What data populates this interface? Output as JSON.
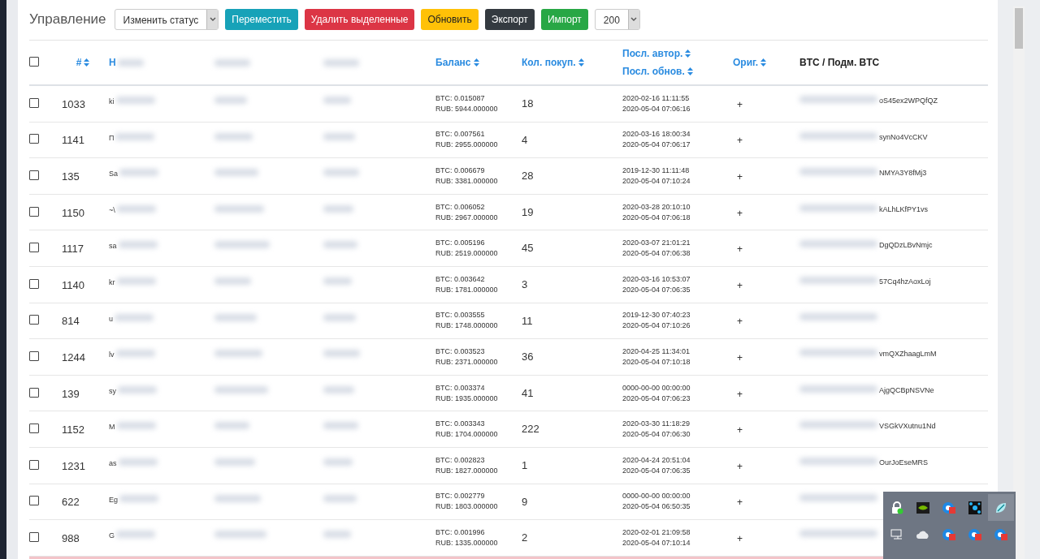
{
  "toolbar": {
    "title": "Управление",
    "status_select": "Изменить статус",
    "buttons": [
      {
        "label": "Переместить",
        "kind": "info"
      },
      {
        "label": "Удалить выделенные",
        "kind": "danger"
      },
      {
        "label": "Обновить",
        "kind": "warning"
      },
      {
        "label": "Экспорт",
        "kind": "dark"
      },
      {
        "label": "Импорт",
        "kind": "success"
      }
    ],
    "page_size": "200"
  },
  "table": {
    "select_all": {
      "checked": false
    },
    "columns": [
      {
        "label": "#",
        "sortable": true,
        "kind": "link"
      },
      {
        "label": "Н",
        "kind": "redacted-link"
      },
      {
        "kind": "redacted-link-only"
      },
      {
        "kind": "redacted-only"
      },
      {
        "label": "Баланс",
        "sortable": true,
        "kind": "link"
      },
      {
        "label": "Кол. покуп.",
        "sortable": true,
        "kind": "link"
      },
      {
        "label": "Посл. автор.",
        "label2": "Посл. обнов.",
        "sortable": true,
        "kind": "double"
      },
      {
        "label": "Ориг.",
        "sortable": true,
        "kind": "link"
      },
      {
        "label": "BTC / Подм. BTC",
        "kind": "plain"
      }
    ],
    "rows": [
      {
        "checked": false,
        "id": "1033",
        "name": "ki",
        "btc": "BTC: 0.015087",
        "rub": "RUB: 5944.000000",
        "purchases": "18",
        "auth": "2020-02-16 11:11:55",
        "upd": "2020-05-04 07:06:16",
        "orig": "+",
        "wallet": "oS45ex2WPQfQZ"
      },
      {
        "checked": false,
        "id": "1141",
        "name": "П",
        "btc": "BTC: 0.007561",
        "rub": "RUB: 2955.000000",
        "purchases": "4",
        "auth": "2020-03-16 18:00:34",
        "upd": "2020-05-04 07:06:17",
        "orig": "+",
        "wallet": "synNo4VcCKV"
      },
      {
        "checked": false,
        "id": "135",
        "name": "Sa",
        "btc": "BTC: 0.006679",
        "rub": "RUB: 3381.000000",
        "purchases": "28",
        "auth": "2019-12-30 11:11:48",
        "upd": "2020-05-04 07:10:24",
        "orig": "+",
        "wallet": "NMYA3Y8fMj3"
      },
      {
        "checked": false,
        "id": "1150",
        "name": "~\\",
        "btc": "BTC: 0.006052",
        "rub": "RUB: 2967.000000",
        "purchases": "19",
        "auth": "2020-03-28 20:10:10",
        "upd": "2020-05-04 07:06:18",
        "orig": "+",
        "wallet": "kALhLKfPY1vs"
      },
      {
        "checked": false,
        "id": "1117",
        "name": "sa",
        "btc": "BTC: 0.005196",
        "rub": "RUB: 2519.000000",
        "purchases": "45",
        "auth": "2020-03-07 21:01:21",
        "upd": "2020-05-04 07:06:38",
        "orig": "+",
        "wallet": "DgQDzLBvNmjc"
      },
      {
        "checked": false,
        "id": "1140",
        "name": "kr",
        "btc": "BTC: 0.003642",
        "rub": "RUB: 1781.000000",
        "purchases": "3",
        "auth": "2020-03-16 10:53:07",
        "upd": "2020-05-04 07:06:35",
        "orig": "+",
        "wallet": "57Cq4hzAoxLoj"
      },
      {
        "checked": false,
        "id": "814",
        "name": "u",
        "btc": "BTC: 0.003555",
        "rub": "RUB: 1748.000000",
        "purchases": "11",
        "auth": "2019-12-30 07:40:23",
        "upd": "2020-05-04 07:10:26",
        "orig": "+"
      },
      {
        "checked": false,
        "id": "1244",
        "name": "lv",
        "btc": "BTC: 0.003523",
        "rub": "RUB: 2371.000000",
        "purchases": "36",
        "auth": "2020-04-25 11:34:01",
        "upd": "2020-05-04 07:10:18",
        "orig": "+",
        "wallet": "vmQXZhaagLmM"
      },
      {
        "checked": false,
        "id": "139",
        "name": "sy",
        "btc": "BTC: 0.003374",
        "rub": "RUB: 1935.000000",
        "purchases": "41",
        "auth": "0000-00-00 00:00:00",
        "upd": "2020-05-04 07:06:23",
        "orig": "+",
        "wallet": "AjgQCBpNSVNe"
      },
      {
        "checked": false,
        "id": "1152",
        "name": "M",
        "btc": "BTC: 0.003343",
        "rub": "RUB: 1704.000000",
        "purchases": "222",
        "auth": "2020-03-30 11:18:29",
        "upd": "2020-05-04 07:06:30",
        "orig": "+",
        "wallet": "VSGkVXutnu1Nd"
      },
      {
        "checked": false,
        "id": "1231",
        "name": "as",
        "btc": "BTC: 0.002823",
        "rub": "RUB: 1827.000000",
        "purchases": "1",
        "auth": "2020-04-24 20:51:04",
        "upd": "2020-05-04 07:06:35",
        "orig": "+",
        "wallet": "OurJoEseMRS"
      },
      {
        "checked": false,
        "id": "622",
        "name": "Eg",
        "btc": "BTC: 0.002779",
        "rub": "RUB: 1803.000000",
        "purchases": "9",
        "auth": "0000-00-00 00:00:00",
        "upd": "2020-05-04 06:50:35",
        "orig": "+"
      },
      {
        "checked": false,
        "id": "988",
        "name": "G",
        "btc": "BTC: 0.001996",
        "rub": "RUB: 1335.000000",
        "purchases": "2",
        "auth": "2020-02-01 21:09:58",
        "upd": "2020-05-04 07:10:14",
        "orig": "+"
      }
    ]
  },
  "tray": {
    "icons": [
      {
        "kind": "lock"
      },
      {
        "kind": "gpu"
      },
      {
        "kind": "badge"
      },
      {
        "kind": "molecule"
      },
      {
        "kind": "leaf",
        "selected": true
      },
      {
        "kind": "monitor"
      },
      {
        "kind": "cloud"
      },
      {
        "kind": "badge"
      },
      {
        "kind": "badge"
      },
      {
        "kind": "badge"
      }
    ]
  }
}
